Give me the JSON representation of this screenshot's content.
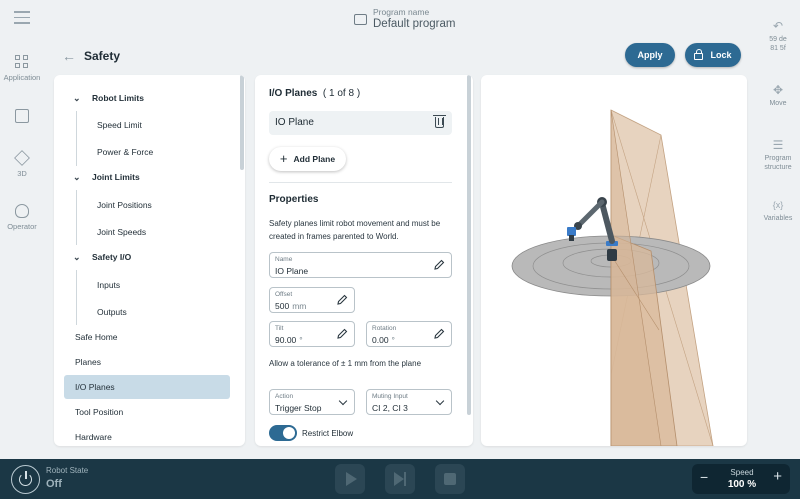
{
  "header": {
    "program_sub": "Program name",
    "program_title": "Default program",
    "page_title": "Safety",
    "apply_label": "Apply",
    "lock_label": "Lock"
  },
  "left_rail": {
    "items": [
      {
        "label": "Application",
        "icon": "grid-icon"
      },
      {
        "label": "",
        "icon": "screen-icon"
      },
      {
        "label": "3D",
        "icon": "cube-icon"
      },
      {
        "label": "Operator",
        "icon": "user-icon"
      }
    ]
  },
  "right_rail": {
    "items": [
      {
        "label": "59 de 81 5f",
        "icon": "undo-icon"
      },
      {
        "label": "Move",
        "icon": "move-icon"
      },
      {
        "label": "Program structure",
        "icon": "list-icon"
      },
      {
        "label": "Variables",
        "icon": "variables-icon"
      }
    ]
  },
  "nav": {
    "robot_limits": "Robot Limits",
    "speed_limit": "Speed Limit",
    "power_force": "Power & Force",
    "joint_limits": "Joint Limits",
    "joint_positions": "Joint Positions",
    "joint_speeds": "Joint Speeds",
    "safety_io": "Safety I/O",
    "inputs": "Inputs",
    "outputs": "Outputs",
    "safe_home": "Safe Home",
    "planes": "Planes",
    "io_planes": "I/O Planes",
    "tool_position": "Tool Position",
    "hardware": "Hardware",
    "selected": "I/O Planes"
  },
  "form": {
    "title": "I/O Planes",
    "count": "( 1 of 8 )",
    "plane_item": "IO Plane",
    "add_plane": "Add Plane",
    "properties_title": "Properties",
    "properties_desc": "Safety planes limit robot movement and must be created in frames parented to World.",
    "name_label": "Name",
    "name_value": "IO Plane",
    "offset_label": "Offset",
    "offset_value": "500",
    "offset_unit": "mm",
    "tilt_label": "Tilt",
    "tilt_value": "90.00",
    "tilt_unit": "°",
    "rotation_label": "Rotation",
    "rotation_value": "0.00",
    "rotation_unit": "°",
    "tolerance_text": "Allow a tolerance of ± 1 mm from the plane",
    "action_label": "Action",
    "action_value": "Trigger Stop",
    "muting_label": "Muting Input",
    "muting_value": "CI 2, CI 3",
    "restrict_elbow_label": "Restrict Elbow",
    "restrict_elbow_on": true
  },
  "bottom": {
    "robot_state_label": "Robot State",
    "robot_state_value": "Off",
    "speed_label": "Speed",
    "speed_value": "100 %"
  },
  "colors": {
    "primary": "#2d6a93",
    "bottom_bar": "#1b3745",
    "selected_row": "#c8dbe7",
    "plane_fill": "#d9b99b"
  }
}
